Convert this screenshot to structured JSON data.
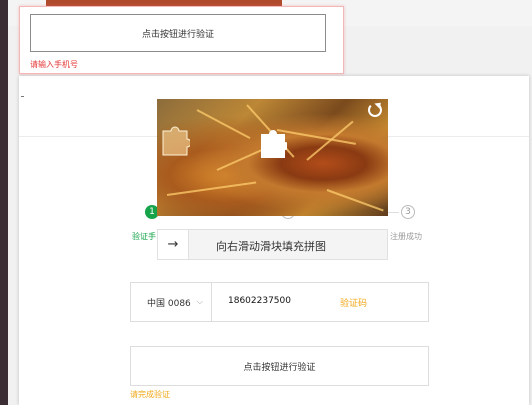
{
  "popup": {
    "button_label": "点击按钮进行验证",
    "error_text": "请输入手机号"
  },
  "steps": [
    {
      "number": "1",
      "label": "验证手",
      "state": "active",
      "color": "#16a34a"
    },
    {
      "number": "",
      "label": "",
      "state": "pending"
    },
    {
      "number": "3",
      "label": "注册成功",
      "state": "pending"
    }
  ],
  "captcha": {
    "slider_text": "向右滑动滑块填充拼图",
    "handle_icon": "arrow-right-icon",
    "refresh_icon": "refresh-icon"
  },
  "phone": {
    "country_code": "中国 0086",
    "number": "18602237500",
    "get_code_label": "验证码"
  },
  "verify": {
    "button_label": "点击按钮进行验证",
    "hint": "请完成验证"
  },
  "colors": {
    "accent": "#f0a81a",
    "error": "#e43535",
    "success": "#16a34a"
  }
}
